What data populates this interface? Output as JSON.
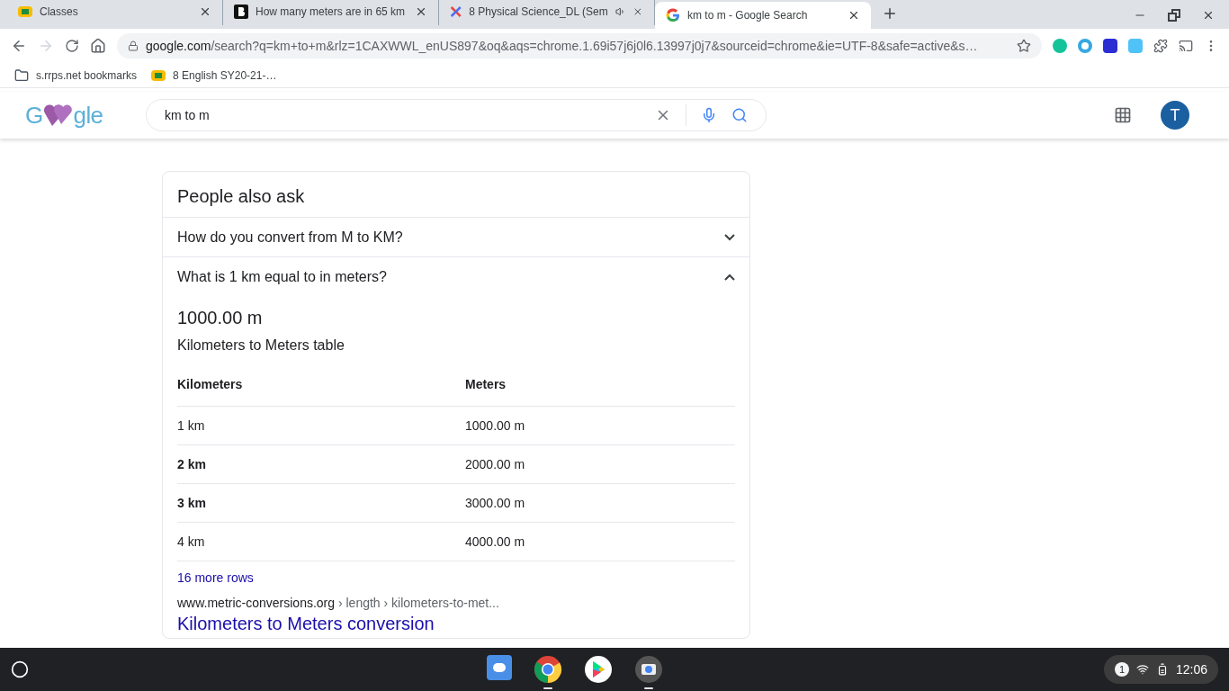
{
  "browser": {
    "tabs": [
      {
        "title": "Classes",
        "selected": false,
        "audio": false
      },
      {
        "title": "How many meters are in 65 km",
        "selected": false,
        "audio": false
      },
      {
        "title": "8 Physical Science_DL (Sem",
        "selected": false,
        "audio": true
      },
      {
        "title": "km to m - Google Search",
        "selected": true,
        "audio": false
      }
    ],
    "address": {
      "host": "google.com",
      "path": "/search?q=km+to+m&rlz=1CAXWWL_enUS897&oq&aqs=chrome.1.69i57j6j0l6.13997j0j7&sourceid=chrome&ie=UTF-8&safe=active&s…"
    },
    "bookmarks": [
      {
        "label": "s.rrps.net bookmarks"
      },
      {
        "label": "8 English SY20-21-…"
      }
    ]
  },
  "header": {
    "logo": {
      "start": "G",
      "end": "gle"
    },
    "search": {
      "value": "km to m"
    },
    "avatar": "T"
  },
  "people_also_ask": {
    "title": "People also ask",
    "questions": [
      {
        "text": "How do you convert from M to KM?",
        "expanded": false
      },
      {
        "text": "What is 1 km equal to in meters?",
        "expanded": true
      }
    ],
    "answer": {
      "value": "1000.00 m",
      "caption": "Kilometers to Meters table",
      "columns": [
        "Kilometers",
        "Meters"
      ],
      "rows": [
        {
          "cells": [
            "1 km",
            "1000.00 m"
          ],
          "emphasized": false
        },
        {
          "cells": [
            "2 km",
            "2000.00 m"
          ],
          "emphasized": true
        },
        {
          "cells": [
            "3 km",
            "3000.00 m"
          ],
          "emphasized": true
        },
        {
          "cells": [
            "4 km",
            "4000.00 m"
          ],
          "emphasized": false
        }
      ],
      "more": "16 more rows",
      "source": {
        "site": "www.metric-conversions.org",
        "path": " › length › kilometers-to-met..."
      },
      "link": "Kilometers to Meters conversion"
    }
  },
  "shelf": {
    "apps": [
      {
        "kind": "messages",
        "active": false
      },
      {
        "kind": "chrome",
        "active": true
      },
      {
        "kind": "play",
        "active": false
      },
      {
        "kind": "camera",
        "active": true
      }
    ],
    "notifications": "1",
    "time": "12:06"
  }
}
